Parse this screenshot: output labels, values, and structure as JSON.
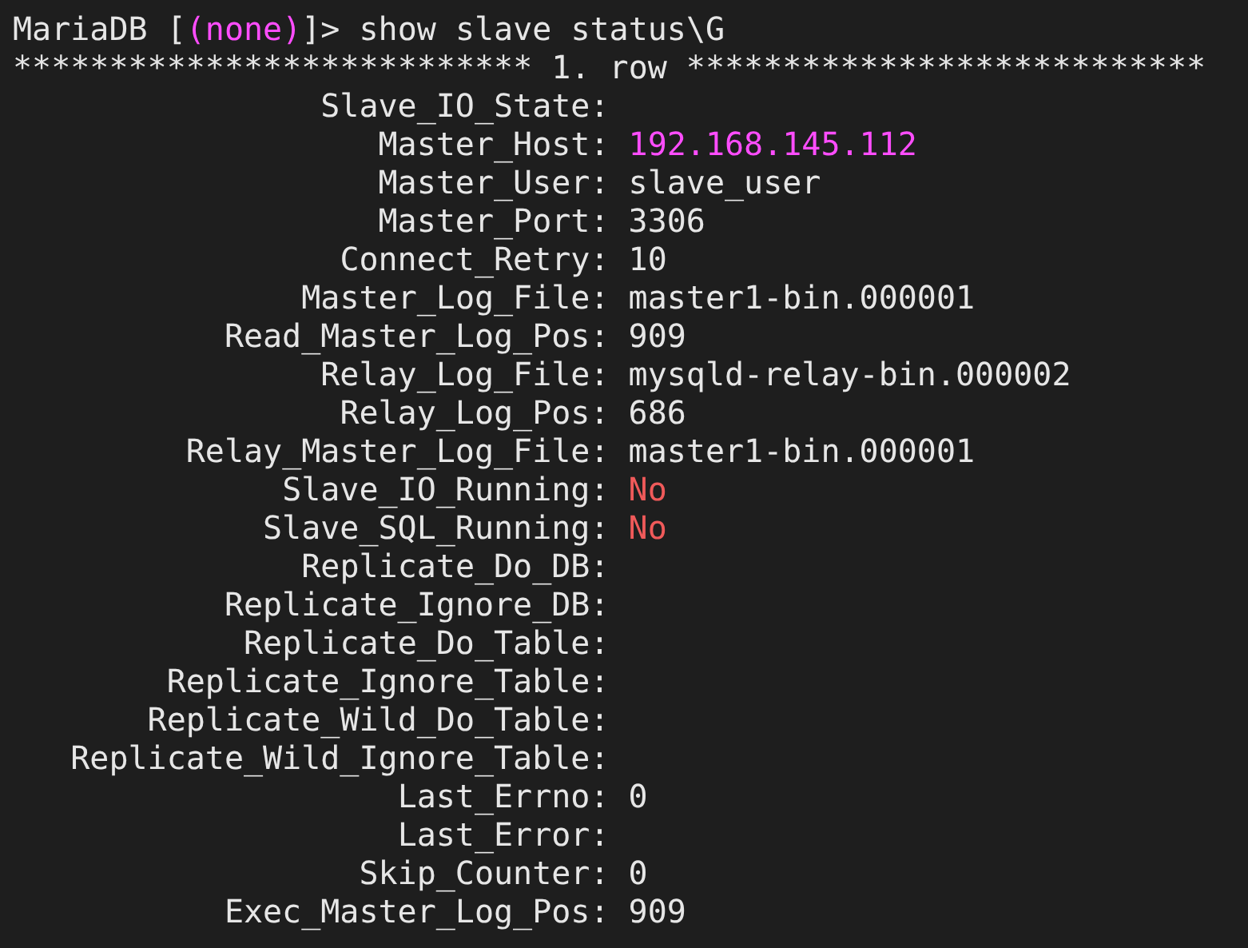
{
  "prompt": {
    "prefix": "MariaDB [",
    "database": "(none)",
    "suffix": "]>",
    "command": "show slave status\\G"
  },
  "row_header": "*************************** 1. row ***************************",
  "fields": [
    {
      "key": "Slave_IO_State:"
    },
    {
      "key": "Master_Host:",
      "value": "192.168.145.112",
      "kind": "address"
    },
    {
      "key": "Master_User:",
      "value": "slave_user",
      "kind": "text"
    },
    {
      "key": "Master_Port:",
      "value": "3306",
      "kind": "text"
    },
    {
      "key": "Connect_Retry:",
      "value": "10",
      "kind": "text"
    },
    {
      "key": "Master_Log_File:",
      "value": "master1-bin.000001",
      "kind": "text"
    },
    {
      "key": "Read_Master_Log_Pos:",
      "value": "909",
      "kind": "text"
    },
    {
      "key": "Relay_Log_File:",
      "value": "mysqld-relay-bin.000002",
      "kind": "text"
    },
    {
      "key": "Relay_Log_Pos:",
      "value": "686",
      "kind": "text"
    },
    {
      "key": "Relay_Master_Log_File:",
      "value": "master1-bin.000001",
      "kind": "text"
    },
    {
      "key": "Slave_IO_Running:",
      "value": "No",
      "kind": "negative"
    },
    {
      "key": "Slave_SQL_Running:",
      "value": "No",
      "kind": "negative"
    },
    {
      "key": "Replicate_Do_DB:"
    },
    {
      "key": "Replicate_Ignore_DB:"
    },
    {
      "key": "Replicate_Do_Table:"
    },
    {
      "key": "Replicate_Ignore_Table:"
    },
    {
      "key": "Replicate_Wild_Do_Table:"
    },
    {
      "key": "Replicate_Wild_Ignore_Table:"
    },
    {
      "key": "Last_Errno:",
      "value": "0",
      "kind": "text"
    },
    {
      "key": "Last_Error:"
    },
    {
      "key": "Skip_Counter:",
      "value": "0",
      "kind": "text"
    },
    {
      "key": "Exec_Master_Log_Pos:",
      "value": "909",
      "kind": "text"
    }
  ]
}
